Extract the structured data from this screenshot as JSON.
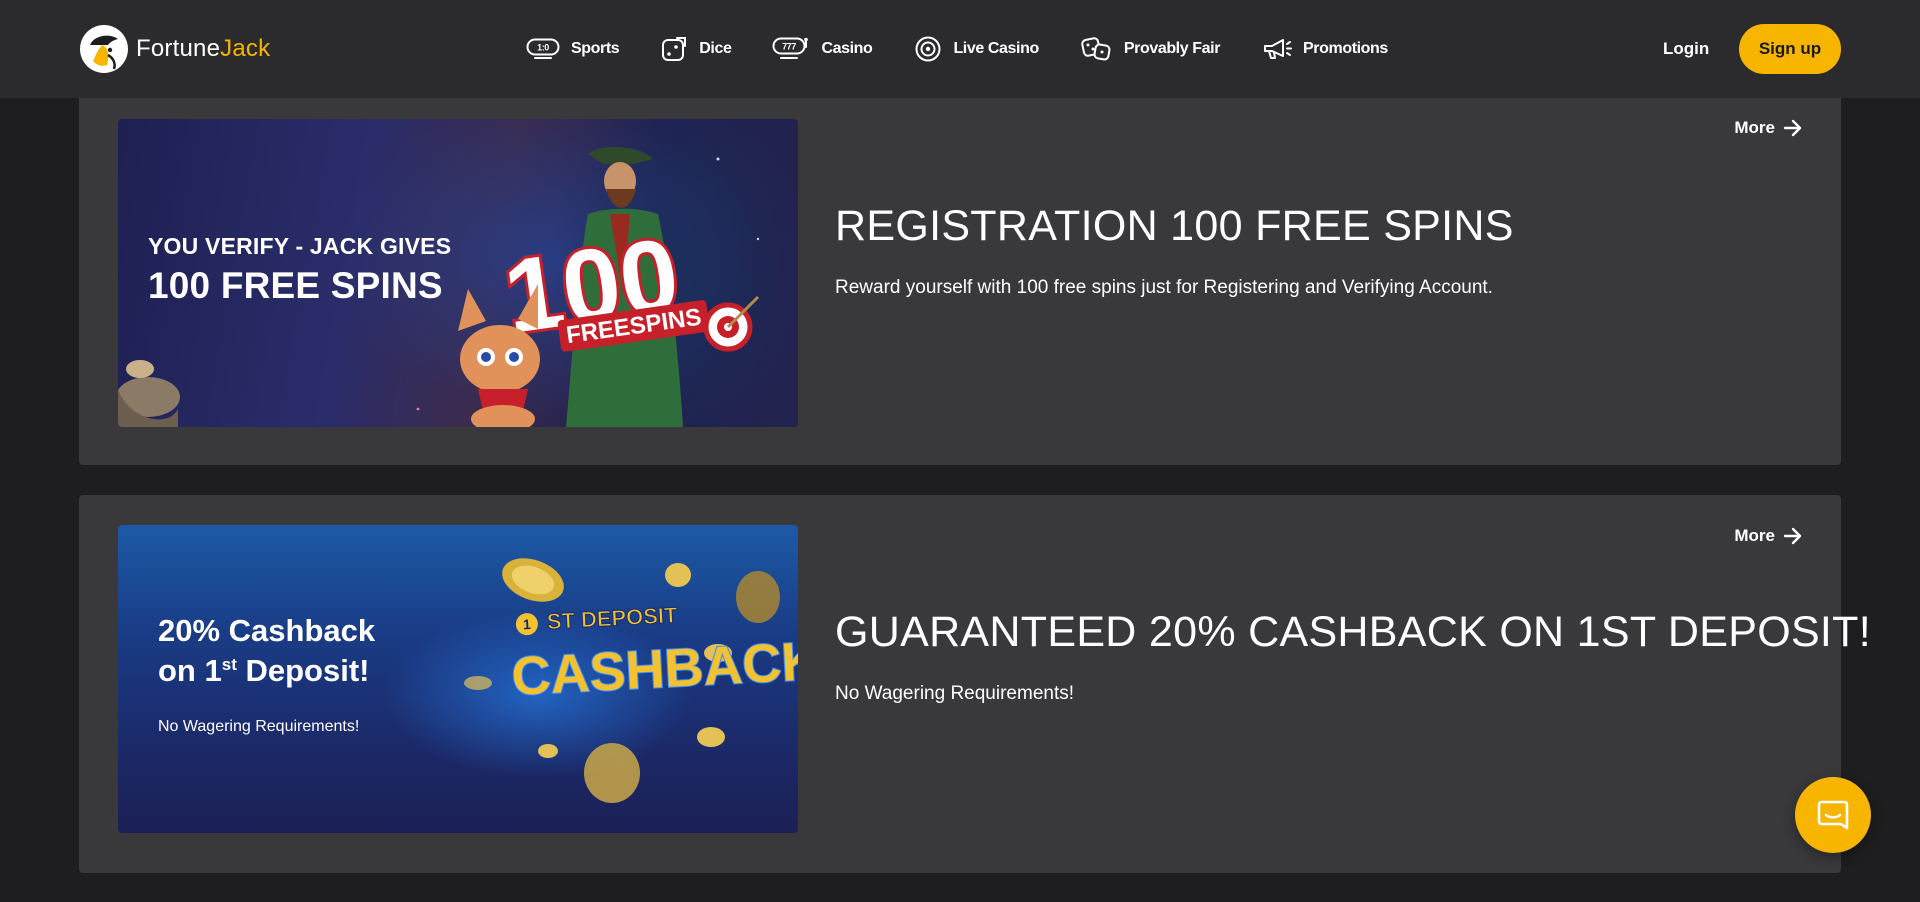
{
  "header": {
    "logo": {
      "word1": "Fortune",
      "word2": "Jack",
      "icon": "fortunejack-pirate-logo-icon"
    },
    "nav": [
      {
        "label": "Sports",
        "icon": "sports-score-icon"
      },
      {
        "label": "Dice",
        "icon": "dice-icon"
      },
      {
        "label": "Casino",
        "icon": "slot-777-icon"
      },
      {
        "label": "Live Casino",
        "icon": "live-casino-chip-icon"
      },
      {
        "label": "Provably Fair",
        "icon": "provably-fair-dice-icon"
      },
      {
        "label": "Promotions",
        "icon": "megaphone-icon"
      }
    ],
    "login_label": "Login",
    "signup_label": "Sign up"
  },
  "promos": [
    {
      "more_label": "More",
      "title": "REGISTRATION 100 FREE SPINS",
      "description": "Reward yourself with 100 free spins just for Registering and Verifying Account.",
      "banner": {
        "line1": "YOU VERIFY - JACK GIVES",
        "line2": "100 FREE SPINS",
        "badge_number": "100",
        "badge_text": "FREESPINS"
      }
    },
    {
      "more_label": "More",
      "title": "GUARANTEED 20% CASHBACK ON 1ST DEPOSIT!",
      "description": "No Wagering Requirements!",
      "banner": {
        "line1": "20% Cashback",
        "line2_prefix": "on 1",
        "line2_sup": "st",
        "line2_suffix": " Deposit!",
        "line3": "No Wagering Requirements!",
        "badge_top": "1ST DEPOSIT",
        "badge_main": "CASHBACK"
      }
    }
  ],
  "colors": {
    "accent": "#f7b500",
    "header_bg": "#2b2a2d",
    "card_bg": "#39383b",
    "page_bg": "#1e1d20"
  },
  "chat": {
    "icon": "chat-bubble-icon"
  }
}
